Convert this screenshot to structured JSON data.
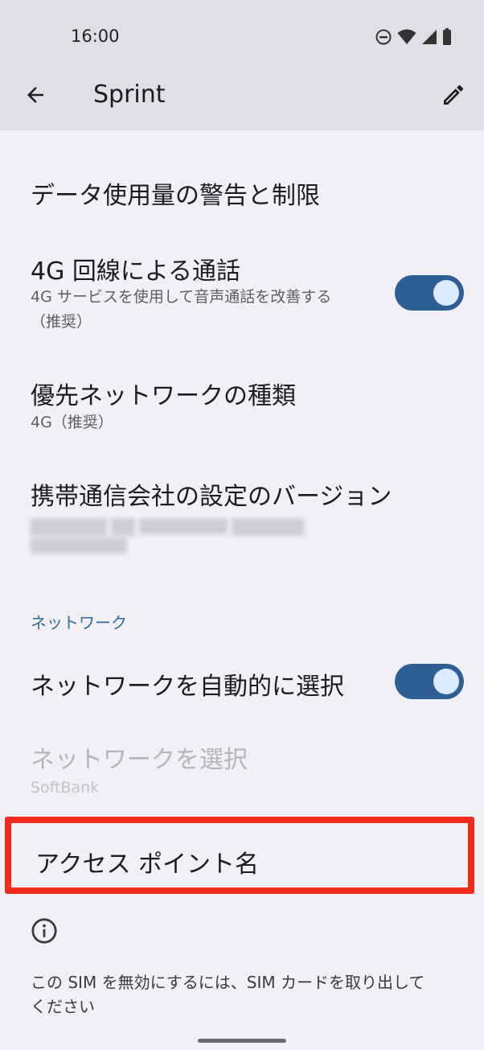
{
  "status_bar": {
    "time": "16:00",
    "icons": [
      "do-not-disturb-icon",
      "wifi-icon",
      "cell-signal-icon",
      "battery-icon"
    ]
  },
  "app_bar": {
    "title": "Sprint",
    "back_icon": "arrow-back-icon",
    "edit_icon": "pencil-icon"
  },
  "settings": {
    "data_warning": {
      "title": "データ使用量の警告と制限"
    },
    "volte": {
      "title": "4G 回線による通話",
      "subtitle_line1": "4G サービスを使用して音声通話を改善する",
      "subtitle_line2": "（推奨）",
      "enabled": true
    },
    "preferred_network": {
      "title": "優先ネットワークの種類",
      "value": "4G（推奨）"
    },
    "carrier_version": {
      "title": "携帯通信会社の設定のバージョン"
    },
    "network_section": {
      "header": "ネットワーク",
      "auto_select": {
        "title": "ネットワークを自動的に選択",
        "enabled": true
      },
      "select_network": {
        "title": "ネットワークを選択",
        "value": "SoftBank",
        "disabled": true
      }
    },
    "apn": {
      "title": "アクセス ポイント名"
    }
  },
  "footer": {
    "info_icon": "info-icon",
    "text_line1": "この SIM を無効にするには、SIM カードを取り出して",
    "text_line2": "ください"
  },
  "colors": {
    "toggle_track": "#2d5f94",
    "toggle_thumb": "#dbeaff",
    "highlight_border": "#f22b1e",
    "section_header": "#2e6e9e"
  }
}
